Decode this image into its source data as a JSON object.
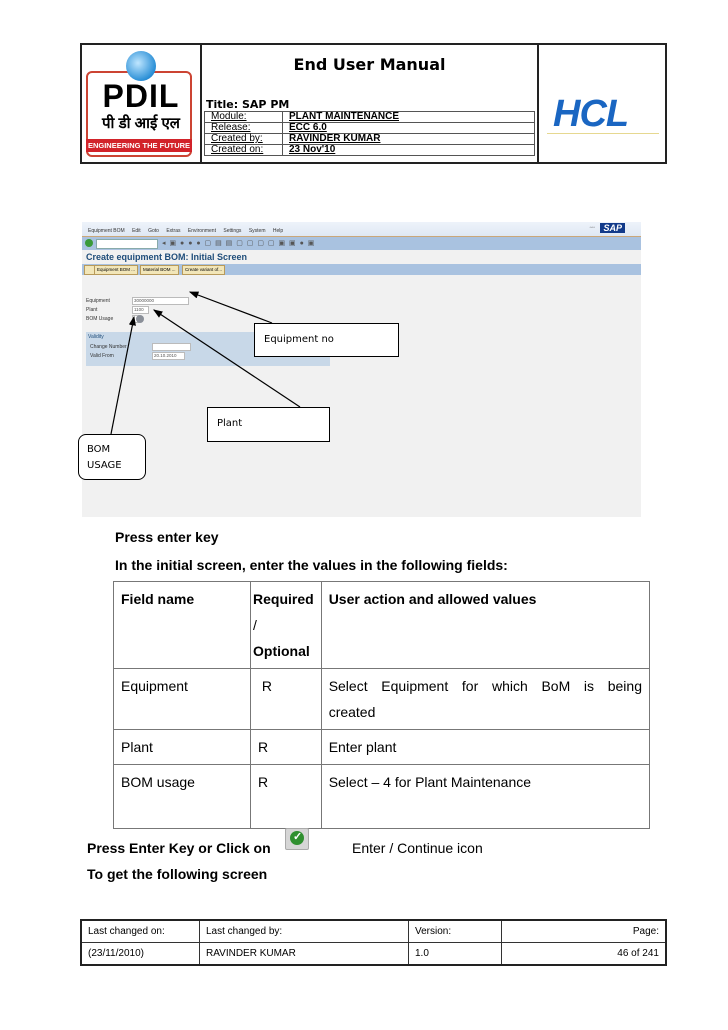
{
  "header": {
    "doc_title": "End User Manual",
    "title_line": "Title: SAP PM",
    "meta": [
      {
        "key": "Module:",
        "value": "PLANT MAINTENANCE"
      },
      {
        "key": "Release:",
        "value": "ECC 6.0"
      },
      {
        "key": "Created by:",
        "value": "RAVINDER KUMAR"
      },
      {
        "key": "Created on:",
        "value": "23 Nov'10"
      }
    ],
    "left_logo": {
      "name": "PDIL",
      "hindi": "पी डी आई एल",
      "tagline": "ENGINEERING THE FUTURE",
      "accent": "#d2232a"
    },
    "right_logo": {
      "name": "HCL",
      "color": "#1a66c2"
    }
  },
  "sap_screen": {
    "menu": [
      "Equipment BOM",
      "Edit",
      "Goto",
      "Extras",
      "Environment",
      "Settings",
      "System",
      "Help"
    ],
    "screen_title": "Create equipment BOM: Initial Screen",
    "app_buttons": [
      "Equipment BOM ...",
      "Material BOM ...",
      "Create variant of..."
    ],
    "fields": [
      {
        "label": "Equipment",
        "value": "30000000"
      },
      {
        "label": "Plant",
        "value": "1100"
      },
      {
        "label": "BOM Usage",
        "value": ""
      }
    ],
    "validity": {
      "title": "Validity",
      "fields": [
        {
          "label": "Change Number",
          "value": ""
        },
        {
          "label": "Valid From",
          "value": "20.10.2010"
        }
      ]
    },
    "sap_logo": "SAP",
    "callouts": {
      "equipment": "Equipment no",
      "plant": "Plant",
      "bom_usage_1": "BOM",
      "bom_usage_2": "USAGE"
    }
  },
  "body": {
    "press_enter": "Press enter key",
    "intro": "In the initial screen, enter the values in the following fields:",
    "table": {
      "headers": [
        "Field name",
        "Required",
        "/",
        "Optional",
        "User action and allowed values"
      ],
      "rows": [
        {
          "field": "Equipment",
          "req": "R",
          "action": "Select Equipment for which BoM  is being",
          "action2": "created"
        },
        {
          "field": "Plant",
          "req": "R",
          "action": "Enter plant"
        },
        {
          "field": "BOM usage",
          "req": "R",
          "action": "Select – 4 for Plant Maintenance"
        }
      ]
    },
    "press_enter_click": "Press Enter Key or Click on",
    "enter_icon_label": "Enter / Continue icon",
    "following": "To get the following screen"
  },
  "footer": {
    "labels": [
      "Last changed on:",
      "Last changed by:",
      "Version:",
      "Page:"
    ],
    "values": [
      "(23/11/2010)",
      "RAVINDER KUMAR",
      "1.0",
      "46 of 241"
    ]
  }
}
